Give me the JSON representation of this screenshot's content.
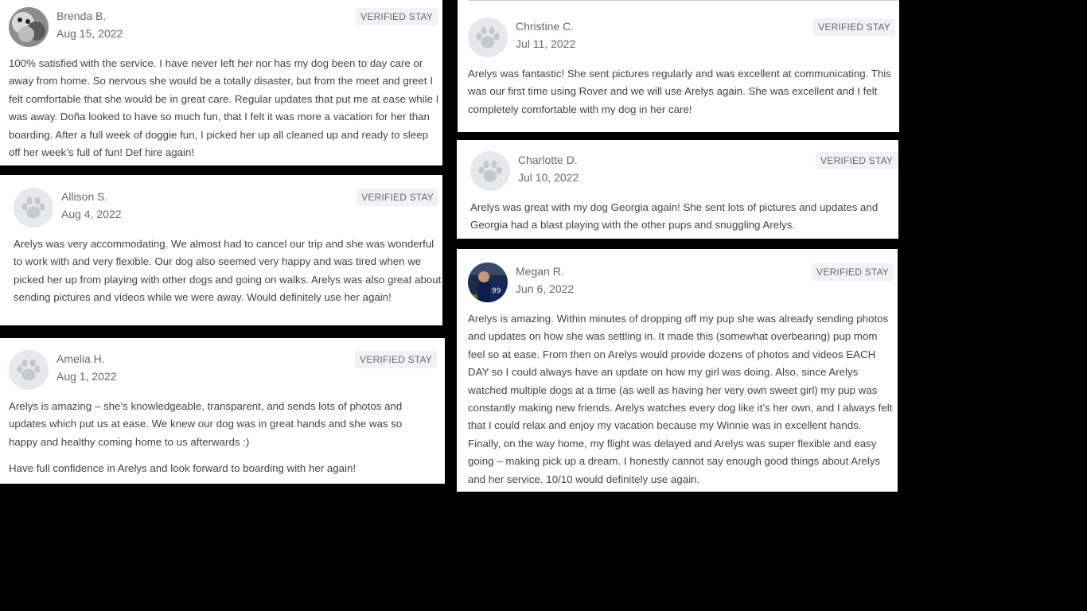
{
  "badge_label": "VERIFIED STAY",
  "colors": {
    "page_background": "#000000",
    "card_background": "#ffffff",
    "badge_background": "#f1f2f4",
    "text_primary": "#404347",
    "text_secondary": "#62686e",
    "paw_placeholder": "#e6e8eb"
  },
  "reviews": [
    {
      "name": "Brenda B.",
      "date": "Aug 15, 2022",
      "avatar": "photo-dog-avatar",
      "paragraphs": [
        "100% satisfied with the service. I have never left her nor has my dog been to day care or away from home. So nervous she would be a totally disaster, but from the meet and greet I felt comfortable that she would be in great care. Regular updates that put me at ease while I was away. Doña looked to have so much fun, that I felt it was more a vacation for her than boarding. After a full week of doggie fun, I picked her up all cleaned up and ready to sleep off her week’s full of fun! Def hire again!"
      ]
    },
    {
      "name": "Allison S.",
      "date": "Aug 4, 2022",
      "avatar": "paw-icon",
      "paragraphs": [
        "Arelys was very accommodating. We almost had to cancel our trip and she was wonderful to work with and very flexible. Our dog also seemed very happy and was tired when we picked her up from playing with other dogs and going on walks. Arelys was also great about sending pictures and videos while we were away. Would definitely use her again!"
      ]
    },
    {
      "name": "Amelia H.",
      "date": "Aug 1, 2022",
      "avatar": "paw-icon",
      "paragraphs": [
        "Arelys is amazing – she’s knowledgeable, transparent, and sends lots of photos and updates which put us at ease. We knew our dog was in great hands and she was so happy and healthy coming home to us afterwards :)",
        "Have full confidence in Arelys and look forward to boarding with her again!"
      ]
    },
    {
      "name": "Christine C.",
      "date": "Jul 11, 2022",
      "avatar": "paw-icon",
      "paragraphs": [
        "Arelys was fantastic! She sent pictures regularly and was excellent at communicating. This was our first time using Rover and we will use Arelys again. She was excellent and I felt completely comfortable with my dog in her care!"
      ]
    },
    {
      "name": "Charlotte D.",
      "date": "Jul 10, 2022",
      "avatar": "paw-icon",
      "paragraphs": [
        "Arelys was great with my dog Georgia again! She sent lots of pictures and updates and Georgia had a blast playing with the other pups and snuggling Arelys."
      ]
    },
    {
      "name": "Megan R.",
      "date": "Jun 6, 2022",
      "avatar": "photo-person-avatar",
      "paragraphs": [
        "Arelys is amazing. Within minutes of dropping off my pup she was already sending photos and updates on how she was settling in. It made this (somewhat overbearing) pup mom feel so at ease. From then on Arelys would provide dozens of photos and videos EACH DAY so I could always have an update on how my girl was doing. Also, since Arelys watched multiple dogs at a time (as well as having her very own sweet girl) my pup was constantly making new friends. Arelys watches every dog like it’s her own, and I always felt that I could relax and enjoy my vacation because my Winnie was in excellent hands. Finally, on the way home, my flight was delayed and Arelys was super flexible and easy going – making pick up a dream. I honestly cannot say enough good things about Arelys and her service. 10/10 would definitely use again."
      ]
    }
  ]
}
